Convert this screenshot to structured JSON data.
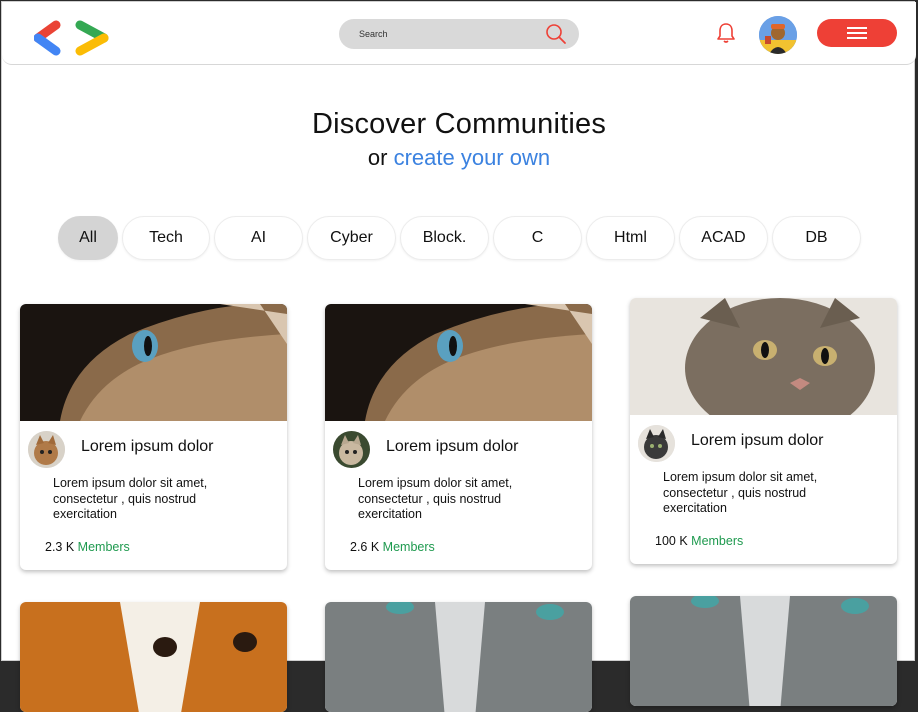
{
  "header": {
    "search_placeholder": "Search",
    "colors": {
      "accent": "#ee4036",
      "link": "#3b82e0",
      "members": "#1f9a4f"
    }
  },
  "hero": {
    "title": "Discover Communities",
    "subtitle_prefix": "or",
    "subtitle_link": "create your own"
  },
  "chips": [
    {
      "label": "All",
      "active": true
    },
    {
      "label": "Tech"
    },
    {
      "label": "AI"
    },
    {
      "label": "Cyber"
    },
    {
      "label": "Block."
    },
    {
      "label": "C"
    },
    {
      "label": "Html"
    },
    {
      "label": "ACAD"
    },
    {
      "label": "DB"
    }
  ],
  "cards": [
    {
      "name": "Lorem ipsum dolor",
      "description": "Lorem ipsum dolor sit amet, consectetur , quis nostrud exercitation",
      "count": "2.3 K",
      "members_label": "Members"
    },
    {
      "name": "Lorem ipsum dolor",
      "description": "Lorem ipsum dolor sit amet, consectetur , quis nostrud exercitation",
      "count": "2.6 K",
      "members_label": "Members"
    },
    {
      "name": "Lorem ipsum dolor",
      "description": "Lorem ipsum dolor sit amet, consectetur , quis nostrud exercitation",
      "count": "100 K",
      "members_label": "Members"
    }
  ]
}
